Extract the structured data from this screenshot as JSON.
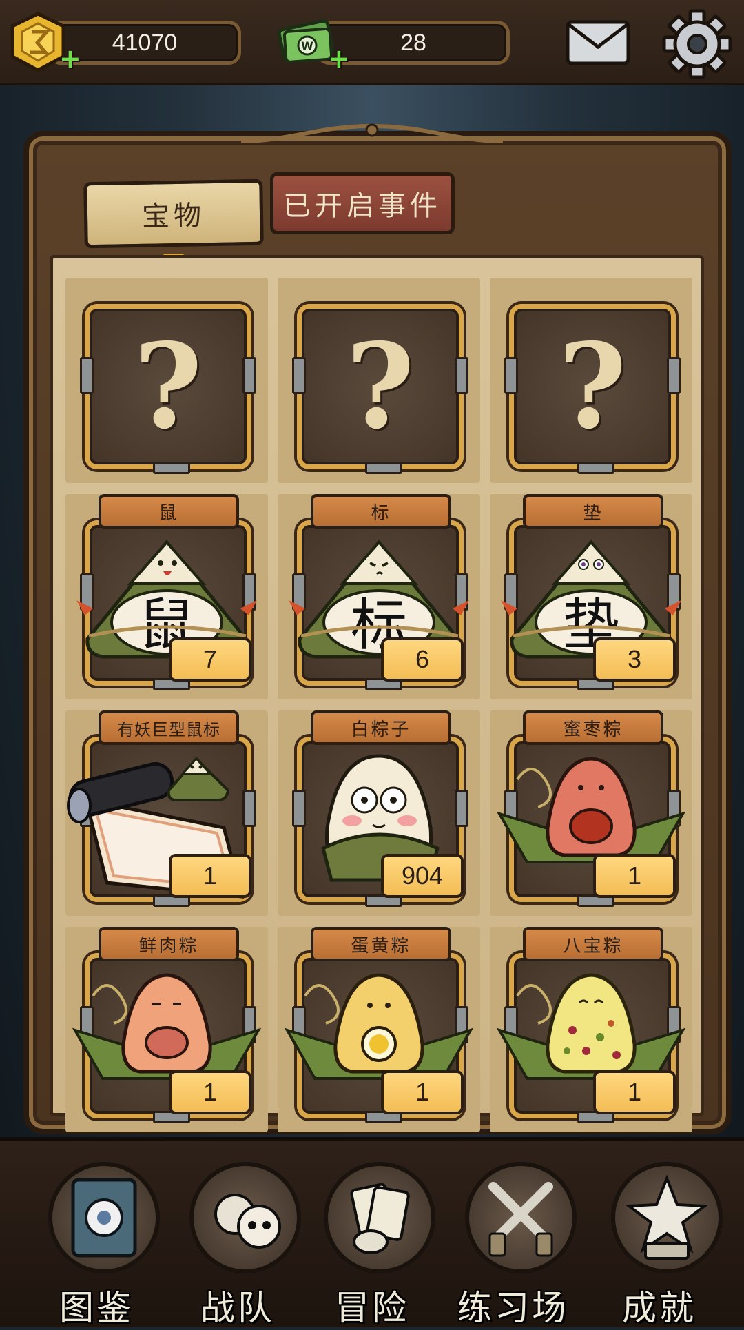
{
  "hud": {
    "gold": {
      "icon": "gold-coin-icon",
      "value": "41070"
    },
    "cash": {
      "icon": "cash-bundle-icon",
      "value": "28"
    },
    "mail_icon": "mail-icon",
    "settings_icon": "gear-icon"
  },
  "tabs": [
    {
      "label": "宝物",
      "active": true
    },
    {
      "label": "已开启事件",
      "active": false
    }
  ],
  "items": [
    {
      "name": "",
      "count": "",
      "locked": true,
      "icon": "question-mark-icon"
    },
    {
      "name": "",
      "count": "",
      "locked": true,
      "icon": "question-mark-icon"
    },
    {
      "name": "",
      "count": "",
      "locked": true,
      "icon": "question-mark-icon"
    },
    {
      "name": "鼠",
      "count": "7",
      "locked": false,
      "icon": "zongzi-glyph-icon",
      "glyph": "鼠"
    },
    {
      "name": "标",
      "count": "6",
      "locked": false,
      "icon": "zongzi-glyph-icon",
      "glyph": "标"
    },
    {
      "name": "垫",
      "count": "3",
      "locked": false,
      "icon": "zongzi-glyph-icon",
      "glyph": "垫"
    },
    {
      "name": "有妖巨型鼠标",
      "count": "1",
      "locked": false,
      "icon": "scroll-zongzi-icon"
    },
    {
      "name": "白粽子",
      "count": "904",
      "locked": false,
      "icon": "white-zongzi-icon"
    },
    {
      "name": "蜜枣粽",
      "count": "1",
      "locked": false,
      "icon": "date-zongzi-icon"
    },
    {
      "name": "鲜肉粽",
      "count": "1",
      "locked": false,
      "icon": "meat-zongzi-icon"
    },
    {
      "name": "蛋黄粽",
      "count": "1",
      "locked": false,
      "icon": "egg-yolk-zongzi-icon"
    },
    {
      "name": "八宝粽",
      "count": "1",
      "locked": false,
      "icon": "eight-treasure-zongzi-icon"
    }
  ],
  "nav": [
    {
      "label": "图鉴",
      "icon": "book-eye-icon"
    },
    {
      "label": "战队",
      "icon": "skulls-icon"
    },
    {
      "label": "冒险",
      "icon": "cards-hand-icon"
    },
    {
      "label": "练习场",
      "icon": "crossed-swords-icon"
    },
    {
      "label": "成就",
      "icon": "star-trophy-icon"
    }
  ],
  "colors": {
    "card_border": "#d9a64a",
    "name_tag": "#c97c3e",
    "count_badge": "#f9c866",
    "tab_active": "#e0cb95",
    "tab_inactive": "#8f4637"
  }
}
